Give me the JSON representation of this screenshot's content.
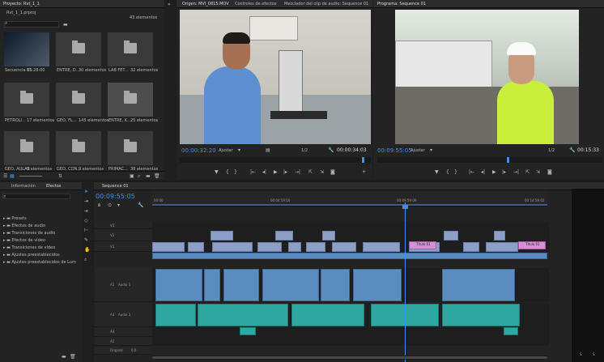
{
  "project": {
    "title": "Proyecto: Rvt_1_1",
    "subtitle": "Rvt_1_1.prproj",
    "count": "43 elementos",
    "items": [
      {
        "name": "Secuencia 01",
        "meta": "15:28:00",
        "kind": "thumb"
      },
      {
        "name": "ENTRE, D...",
        "meta": "30 elementos",
        "kind": "folder"
      },
      {
        "name": "LAB FET...",
        "meta": "32 elementos",
        "kind": "folder"
      },
      {
        "name": "PETROLI...",
        "meta": "17 elementos",
        "kind": "folder"
      },
      {
        "name": "GEO, FL...",
        "meta": "145 elementos",
        "kind": "folder"
      },
      {
        "name": "ENTRE, K...",
        "meta": "25 elementos",
        "kind": "folder"
      },
      {
        "name": "GEO, AULAS",
        "meta": "9 elementos",
        "kind": "folder"
      },
      {
        "name": "GEO, CON...",
        "meta": "9 elementos",
        "kind": "folder"
      },
      {
        "name": "PRIMAC...",
        "meta": "38 elementos",
        "kind": "folder"
      }
    ]
  },
  "source_monitor": {
    "tabs": [
      "Origen: MVI_0815.MOV",
      "Controles de efectos",
      "Mezclador del clip de audio: Sequence 01"
    ],
    "timecode": "00:00:32:20",
    "fit": "Ajustar",
    "res": "1/2",
    "duration": "00:00:34:03"
  },
  "program_monitor": {
    "tab": "Programa: Sequence 01",
    "timecode": "00:09:55:05",
    "fit": "Ajustar",
    "res": "1/2",
    "duration": "00:15:33"
  },
  "effects": {
    "tabs": [
      "Información",
      "Efectos"
    ],
    "items": [
      "Presets",
      "Efectos de audio",
      "Transiciones de audio",
      "Efectos de vídeo",
      "Transiciones de vídeo",
      "Ajustes preestablecidos",
      "Ajustes preestablecidos de Lum"
    ]
  },
  "timeline": {
    "tab": "Sequence 01",
    "timecode": "00:09:55:05",
    "ruler": [
      "00:00",
      "00:04:59:16",
      "00:09:59:09",
      "00:14:59:02"
    ],
    "tracks": [
      {
        "id": "V3"
      },
      {
        "id": "V2"
      },
      {
        "id": "V1"
      },
      {
        "id": "A1",
        "label": "Audio 1"
      },
      {
        "id": "A2"
      },
      {
        "id": "A3",
        "label": "Audio 3"
      },
      {
        "id": "A4"
      },
      {
        "id": "A5"
      }
    ],
    "master": {
      "label": "Original",
      "value": "0,0"
    },
    "title_clip": "Título 01",
    "dsc_label": "DSC"
  },
  "audio_meter": {
    "labels": [
      "S",
      "S"
    ]
  },
  "colors": {
    "accent": "#3f8ff0",
    "video": "#8d9fc6",
    "audio": "#2fa7a1",
    "title": "#d98fd6"
  }
}
